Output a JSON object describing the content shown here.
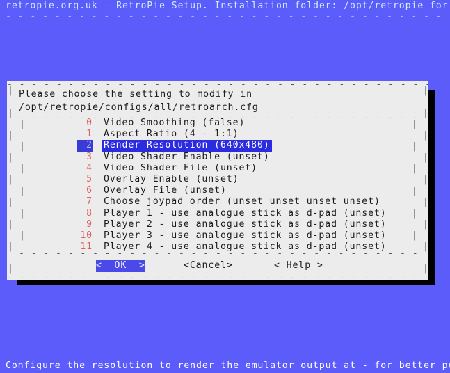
{
  "colors": {
    "screen_background": "#5c5cfa",
    "dialog_background": "#ececed",
    "title_text": "#c8f0f8",
    "tag_text": "#e0615f",
    "highlight_background": "#2b2be0",
    "highlight_text": "#ffffff",
    "shadow": "#000000",
    "status_text": "#ffffff"
  },
  "top_bar": {
    "title": "retropie.org.uk - RetroPie Setup. Installation folder: /opt/retropie for user",
    "rule": "- - - - - - - - - - - - - - - - - - - - - - - - - - - - - - - - - - - - - - - - -"
  },
  "dialog": {
    "prompt_line_1": "Please choose the setting to modify in",
    "prompt_line_2": "/opt/retropie/configs/all/retroarch.cfg",
    "menu": {
      "selected_index": 2,
      "items": [
        {
          "tag": "0",
          "label": "Video Smoothing (false)"
        },
        {
          "tag": "1",
          "label": "Aspect Ratio (4 - 1:1)"
        },
        {
          "tag": "2",
          "label": "Render Resolution (640x480)"
        },
        {
          "tag": "3",
          "label": "Video Shader Enable (unset)"
        },
        {
          "tag": "4",
          "label": "Video Shader File (unset)"
        },
        {
          "tag": "5",
          "label": "Overlay Enable (unset)"
        },
        {
          "tag": "6",
          "label": "Overlay File (unset)"
        },
        {
          "tag": "7",
          "label": "Choose joypad order (unset unset unset unset)"
        },
        {
          "tag": "8",
          "label": "Player 1 - use analogue stick as d-pad (unset)"
        },
        {
          "tag": "9",
          "label": "Player 2 - use analogue stick as d-pad (unset)"
        },
        {
          "tag": "10",
          "label": "Player 3 - use analogue stick as d-pad (unset)"
        },
        {
          "tag": "11",
          "label": "Player 4 - use analogue stick as d-pad (unset)"
        }
      ]
    },
    "buttons": {
      "ok": "<  OK  >",
      "cancel": "<Cancel>",
      "help": "< Help >",
      "focused": "ok"
    }
  },
  "bottom_bar": {
    "status": "Configure the resolution to render the emulator output at - for better perform"
  }
}
